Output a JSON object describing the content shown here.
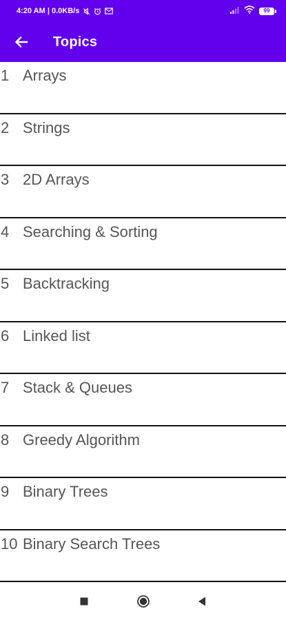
{
  "status_bar": {
    "time": "4:20 AM | 0.0KB/s",
    "battery_level": "99"
  },
  "app_bar": {
    "title": "Topics"
  },
  "topics": [
    {
      "number": "1",
      "label": "Arrays"
    },
    {
      "number": "2",
      "label": "Strings"
    },
    {
      "number": "3",
      "label": "2D Arrays"
    },
    {
      "number": "4",
      "label": "Searching & Sorting"
    },
    {
      "number": "5",
      "label": "Backtracking"
    },
    {
      "number": "6",
      "label": "Linked list"
    },
    {
      "number": "7",
      "label": "Stack & Queues"
    },
    {
      "number": "8",
      "label": "Greedy Algorithm"
    },
    {
      "number": "9",
      "label": "Binary Trees"
    },
    {
      "number": "10",
      "label": "Binary Search Trees"
    }
  ],
  "icons": {
    "back": "arrow-left-icon",
    "nav_recents": "square-icon",
    "nav_home": "circle-icon",
    "nav_back": "triangle-left-icon"
  },
  "colors": {
    "primary": "#6200ee",
    "text": "#555555",
    "divider": "#111111",
    "background": "#ffffff"
  }
}
